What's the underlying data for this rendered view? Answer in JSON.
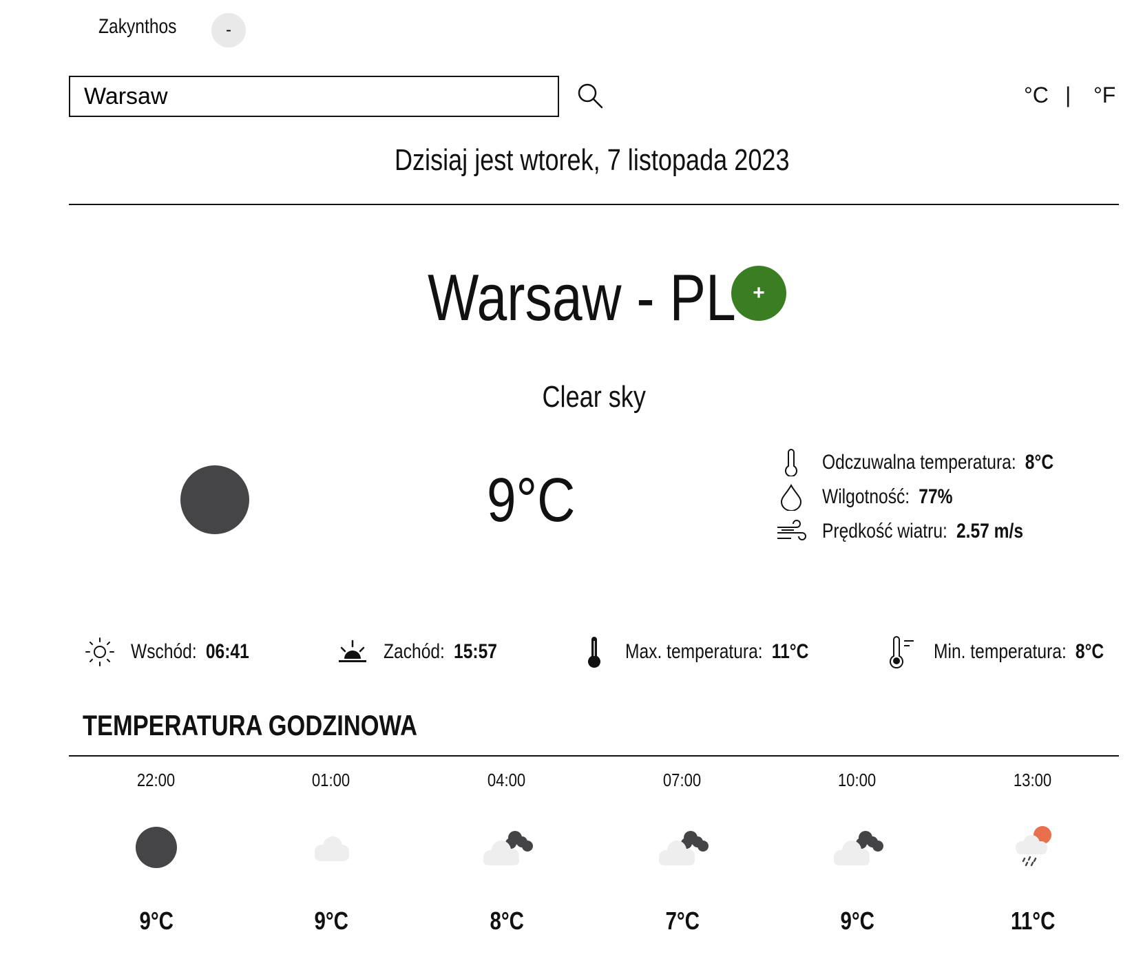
{
  "saved": {
    "city": "Zakynthos",
    "remove_label": "-"
  },
  "search": {
    "value": "Warsaw",
    "placeholder": ""
  },
  "units": {
    "celsius": "°C",
    "separator": "|",
    "fahrenheit": "°F"
  },
  "date_text": "Dzisiaj jest wtorek, 7 listopada 2023",
  "current": {
    "city": "Warsaw - PL",
    "add_label": "+",
    "description": "Clear sky",
    "temp": "9°C",
    "icon": "clear-night-icon",
    "details": [
      {
        "label": "Odczuwalna temperatura:",
        "value": "8°C",
        "icon": "thermometer-icon"
      },
      {
        "label": "Wilgotność:",
        "value": "77%",
        "icon": "humidity-drop-icon"
      },
      {
        "label": "Prędkość wiatru:",
        "value": "2.57 m/s",
        "icon": "wind-icon"
      }
    ]
  },
  "sun": [
    {
      "label": "Wschód:",
      "value": "06:41",
      "icon": "sunrise-icon"
    },
    {
      "label": "Zachód:",
      "value": "15:57",
      "icon": "sunset-icon"
    },
    {
      "label": "Max. temperatura:",
      "value": "11°C",
      "icon": "thermometer-full-icon"
    },
    {
      "label": "Min. temperatura:",
      "value": "8°C",
      "icon": "thermometer-low-icon"
    }
  ],
  "hourly": {
    "title": "TEMPERATURA GODZINOWA",
    "items": [
      {
        "time": "22:00",
        "temp": "9°C",
        "icon": "clear-night-icon"
      },
      {
        "time": "01:00",
        "temp": "9°C",
        "icon": "cloud-icon"
      },
      {
        "time": "04:00",
        "temp": "8°C",
        "icon": "broken-clouds-icon"
      },
      {
        "time": "07:00",
        "temp": "7°C",
        "icon": "broken-clouds-icon"
      },
      {
        "time": "10:00",
        "temp": "9°C",
        "icon": "broken-clouds-icon"
      },
      {
        "time": "13:00",
        "temp": "11°C",
        "icon": "rain-sun-icon"
      }
    ]
  },
  "colors": {
    "accent_green": "#3a7d22",
    "night_icon": "#454547",
    "sun_orange": "#e8704d",
    "cloud_light": "#eeeeee",
    "cloud_dark": "#444446"
  }
}
